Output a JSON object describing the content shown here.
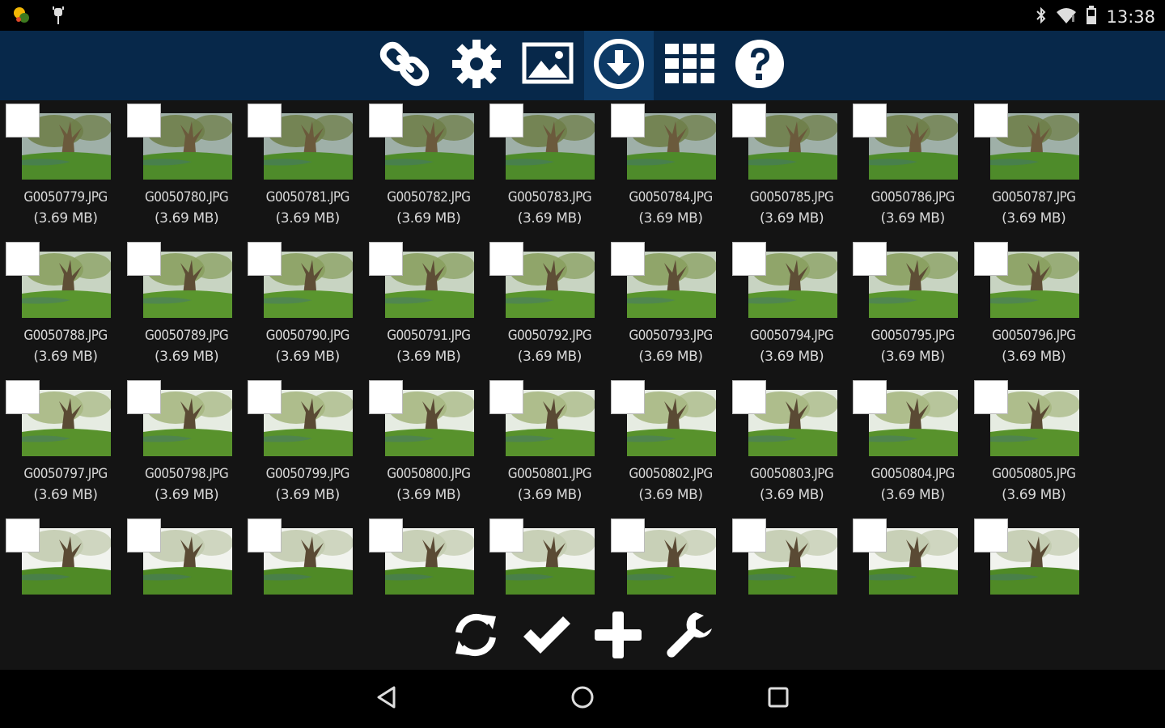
{
  "status_bar": {
    "time": "13:38",
    "left_icons": [
      "weather-notification-icon",
      "android-debug-icon"
    ],
    "right_icons": [
      "bluetooth-icon",
      "wifi-icon",
      "battery-icon"
    ]
  },
  "top_toolbar": {
    "items": [
      {
        "name": "link-icon",
        "label": "connect"
      },
      {
        "name": "gear-icon",
        "label": "settings"
      },
      {
        "name": "image-icon",
        "label": "preview"
      },
      {
        "name": "download-circle-icon",
        "label": "download",
        "active": true
      },
      {
        "name": "grid-icon",
        "label": "grid view"
      },
      {
        "name": "help-icon",
        "label": "help"
      }
    ]
  },
  "files": [
    {
      "name": "G0050779.JPG",
      "size": "(3.69 MB)"
    },
    {
      "name": "G0050780.JPG",
      "size": "(3.69 MB)"
    },
    {
      "name": "G0050781.JPG",
      "size": "(3.69 MB)"
    },
    {
      "name": "G0050782.JPG",
      "size": "(3.69 MB)"
    },
    {
      "name": "G0050783.JPG",
      "size": "(3.69 MB)"
    },
    {
      "name": "G0050784.JPG",
      "size": "(3.69 MB)"
    },
    {
      "name": "G0050785.JPG",
      "size": "(3.69 MB)"
    },
    {
      "name": "G0050786.JPG",
      "size": "(3.69 MB)"
    },
    {
      "name": "G0050787.JPG",
      "size": "(3.69 MB)"
    },
    {
      "name": "G0050788.JPG",
      "size": "(3.69 MB)"
    },
    {
      "name": "G0050789.JPG",
      "size": "(3.69 MB)"
    },
    {
      "name": "G0050790.JPG",
      "size": "(3.69 MB)"
    },
    {
      "name": "G0050791.JPG",
      "size": "(3.69 MB)"
    },
    {
      "name": "G0050792.JPG",
      "size": "(3.69 MB)"
    },
    {
      "name": "G0050793.JPG",
      "size": "(3.69 MB)"
    },
    {
      "name": "G0050794.JPG",
      "size": "(3.69 MB)"
    },
    {
      "name": "G0050795.JPG",
      "size": "(3.69 MB)"
    },
    {
      "name": "G0050796.JPG",
      "size": "(3.69 MB)"
    },
    {
      "name": "G0050797.JPG",
      "size": "(3.69 MB)"
    },
    {
      "name": "G0050798.JPG",
      "size": "(3.69 MB)"
    },
    {
      "name": "G0050799.JPG",
      "size": "(3.69 MB)"
    },
    {
      "name": "G0050800.JPG",
      "size": "(3.69 MB)"
    },
    {
      "name": "G0050801.JPG",
      "size": "(3.69 MB)"
    },
    {
      "name": "G0050802.JPG",
      "size": "(3.69 MB)"
    },
    {
      "name": "G0050803.JPG",
      "size": "(3.69 MB)"
    },
    {
      "name": "G0050804.JPG",
      "size": "(3.69 MB)"
    },
    {
      "name": "G0050805.JPG",
      "size": "(3.69 MB)"
    },
    {
      "name": "",
      "size": ""
    },
    {
      "name": "",
      "size": ""
    },
    {
      "name": "",
      "size": ""
    },
    {
      "name": "",
      "size": ""
    },
    {
      "name": "",
      "size": ""
    },
    {
      "name": "",
      "size": ""
    },
    {
      "name": "",
      "size": ""
    },
    {
      "name": "",
      "size": ""
    },
    {
      "name": "",
      "size": ""
    }
  ],
  "bottom_toolbar": {
    "items": [
      {
        "name": "refresh-icon",
        "label": "refresh"
      },
      {
        "name": "checkmark-icon",
        "label": "select all"
      },
      {
        "name": "plus-icon",
        "label": "add"
      },
      {
        "name": "wrench-icon",
        "label": "tools"
      }
    ]
  },
  "nav_bar": {
    "items": [
      {
        "name": "back-icon",
        "label": "back"
      },
      {
        "name": "home-icon",
        "label": "home"
      },
      {
        "name": "recents-icon",
        "label": "recent apps"
      }
    ]
  },
  "colors": {
    "toolbar_bg": "#07284a",
    "toolbar_active": "#0d3a66",
    "grid_bg": "#141414",
    "text": "#d8d8d8"
  }
}
